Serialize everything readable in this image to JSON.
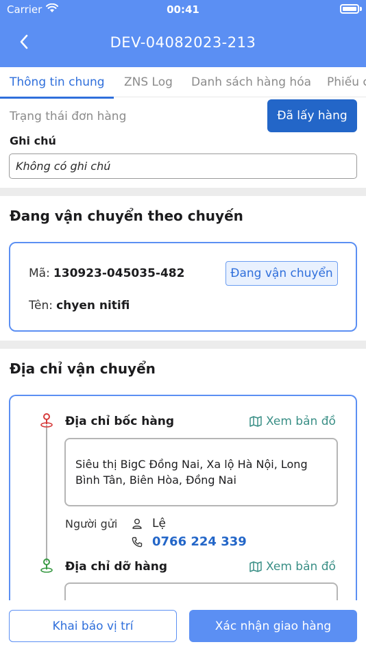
{
  "status_bar": {
    "carrier": "Carrier",
    "time": "00:41"
  },
  "header": {
    "title": "DEV-04082023-213"
  },
  "tabs": [
    {
      "label": "Thông tin chung",
      "active": true
    },
    {
      "label": "ZNS Log",
      "active": false
    },
    {
      "label": "Danh sách hàng hóa",
      "active": false
    },
    {
      "label": "Phiếu c",
      "active": false
    }
  ],
  "order": {
    "status_label": "Trạng thái đơn hàng",
    "status_value": "Đã lấy hàng",
    "note_label": "Ghi chú",
    "note_value": "Không có ghi chú"
  },
  "trip": {
    "section_title": "Đang vận chuyển theo chuyến",
    "code_label": "Mã:",
    "code_value": "130923-045035-482",
    "name_label": "Tên:",
    "name_value": "chyen nitifi",
    "badge": "Đang vận chuyển"
  },
  "shipping": {
    "section_title": "Địa chỉ vận chuyển",
    "pickup_label": "Địa chỉ bốc hàng",
    "map_link": "Xem bản đồ",
    "pickup_address": "Siêu thị BigC Đồng Nai, Xa lộ Hà Nội, Long Bình Tân, Biên Hòa, Đồng Nai",
    "sender_label": "Người gửi",
    "sender_name": "Lệ",
    "sender_phone": "0766 224 339",
    "dropoff_label": "Địa chỉ dỡ hàng",
    "dropoff_map_link": "Xem bản đồ"
  },
  "actions": {
    "report_location": "Khai báo vị trí",
    "confirm_delivery": "Xác nhận giao hàng"
  },
  "colors": {
    "header": "#5b8ff3",
    "primary_button": "#2366c8",
    "accent_text": "#2f6fdb",
    "map_link": "#3a8f86",
    "pickup_pin": "#d63b3b",
    "dropoff_pin": "#3a9a45"
  }
}
